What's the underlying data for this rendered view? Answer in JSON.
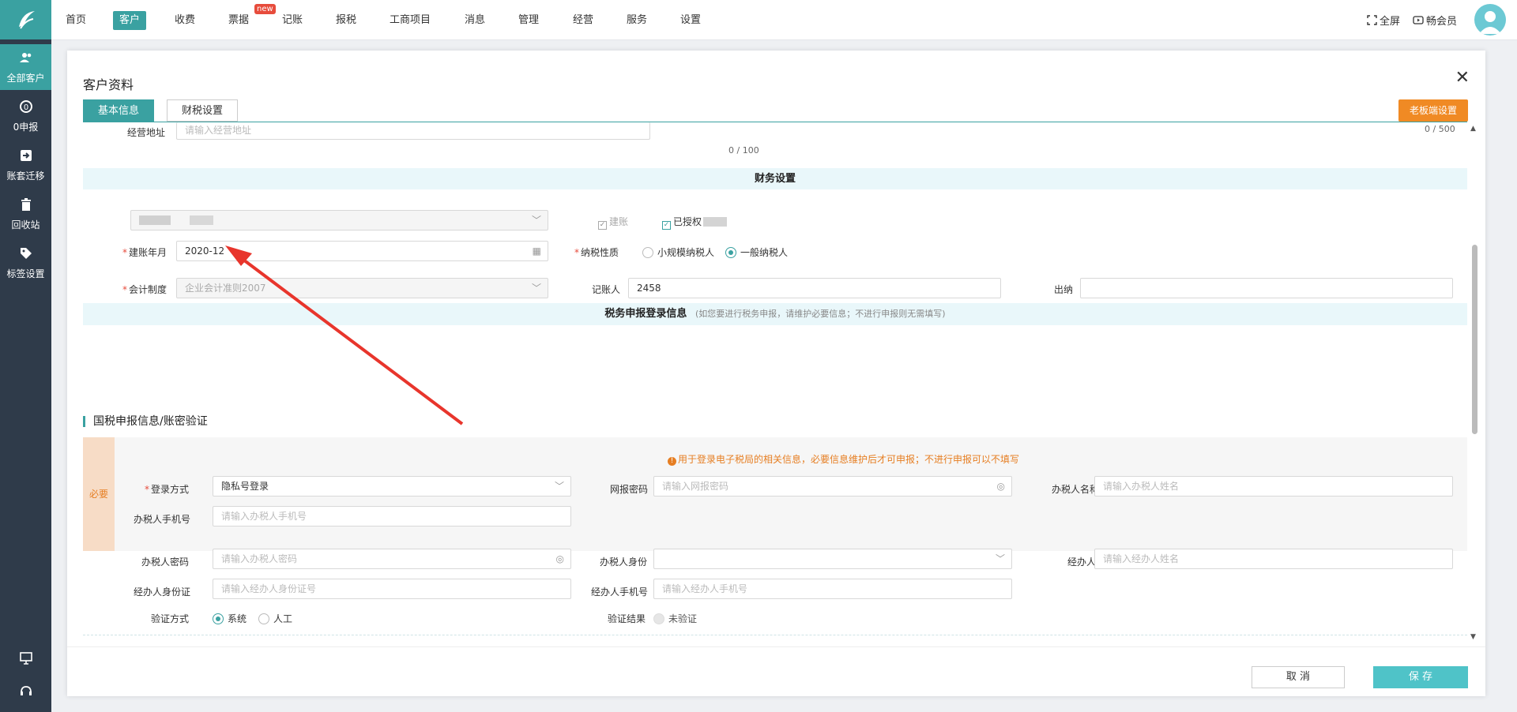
{
  "sidebar": {
    "items": [
      {
        "label": "全部客户",
        "icon": "users-icon"
      },
      {
        "label": "0申报",
        "icon": "zero-report-icon"
      },
      {
        "label": "账套迁移",
        "icon": "migrate-icon"
      },
      {
        "label": "回收站",
        "icon": "trash-icon"
      },
      {
        "label": "标签设置",
        "icon": "tag-icon"
      }
    ]
  },
  "nav": {
    "items": [
      "首页",
      "客户",
      "收费",
      "票据",
      "记账",
      "报税",
      "工商项目",
      "消息",
      "管理",
      "经营",
      "服务",
      "设置"
    ],
    "new_badge": "new",
    "fullscreen": "全屏",
    "member": "畅会员"
  },
  "modal": {
    "title": "客户资料",
    "tabs": [
      "基本信息",
      "财税设置"
    ],
    "boss_settings": "老板端设置",
    "address_label": "经营地址",
    "address_placeholder": "请输入经营地址",
    "address_counter": "0 / 100",
    "right_counter": "0 / 500",
    "finance_section": "财务设置",
    "build_checkbox": "建账",
    "authorized_checkbox": "已授权",
    "build_month_label": "建账年月",
    "build_month_value": "2020-12",
    "taxpayer_label": "纳税性质",
    "taxpayer_options": [
      "小规模纳税人",
      "一般纳税人"
    ],
    "accounting_label": "会计制度",
    "accounting_value": "企业会计准则2007",
    "bookkeeper_label": "记账人",
    "bookkeeper_value": "2458",
    "cashier_label": "出纳",
    "tax_login_section": "税务申报登录信息",
    "tax_login_hint": "(如您要进行税务申报，请维护必要信息；不进行申报则无需填写)",
    "national_tax_title": "国税申报信息/账密验证",
    "required_tag": "必要",
    "notice": "用于登录电子税局的相关信息，必要信息维护后才可申报；不进行申报可以不填写",
    "login_method_label": "登录方式",
    "login_method_value": "隐私号登录",
    "net_password_label": "网报密码",
    "net_password_placeholder": "请输入网报密码",
    "taxer_name_label": "办税人名称",
    "taxer_name_placeholder": "请输入办税人姓名",
    "taxer_phone_label": "办税人手机号",
    "taxer_phone_placeholder": "请输入办税人手机号",
    "taxer_password_label": "办税人密码",
    "taxer_password_placeholder": "请输入办税人密码",
    "taxer_identity_label": "办税人身份",
    "handler_label": "经办人",
    "handler_placeholder": "请输入经办人姓名",
    "handler_id_label": "经办人身份证",
    "handler_id_placeholder": "请输入经办人身份证号",
    "handler_phone_label": "经办人手机号",
    "handler_phone_placeholder": "请输入经办人手机号",
    "verify_method_label": "验证方式",
    "verify_options": [
      "系统",
      "人工"
    ],
    "verify_result_label": "验证结果",
    "verify_result_value": "未验证",
    "cancel": "取 消",
    "save": "保 存"
  },
  "colors": {
    "accent": "#3aa1a1",
    "sidebar": "#2f3b4a",
    "orange": "#f08a24",
    "save": "#4fc3c8"
  }
}
